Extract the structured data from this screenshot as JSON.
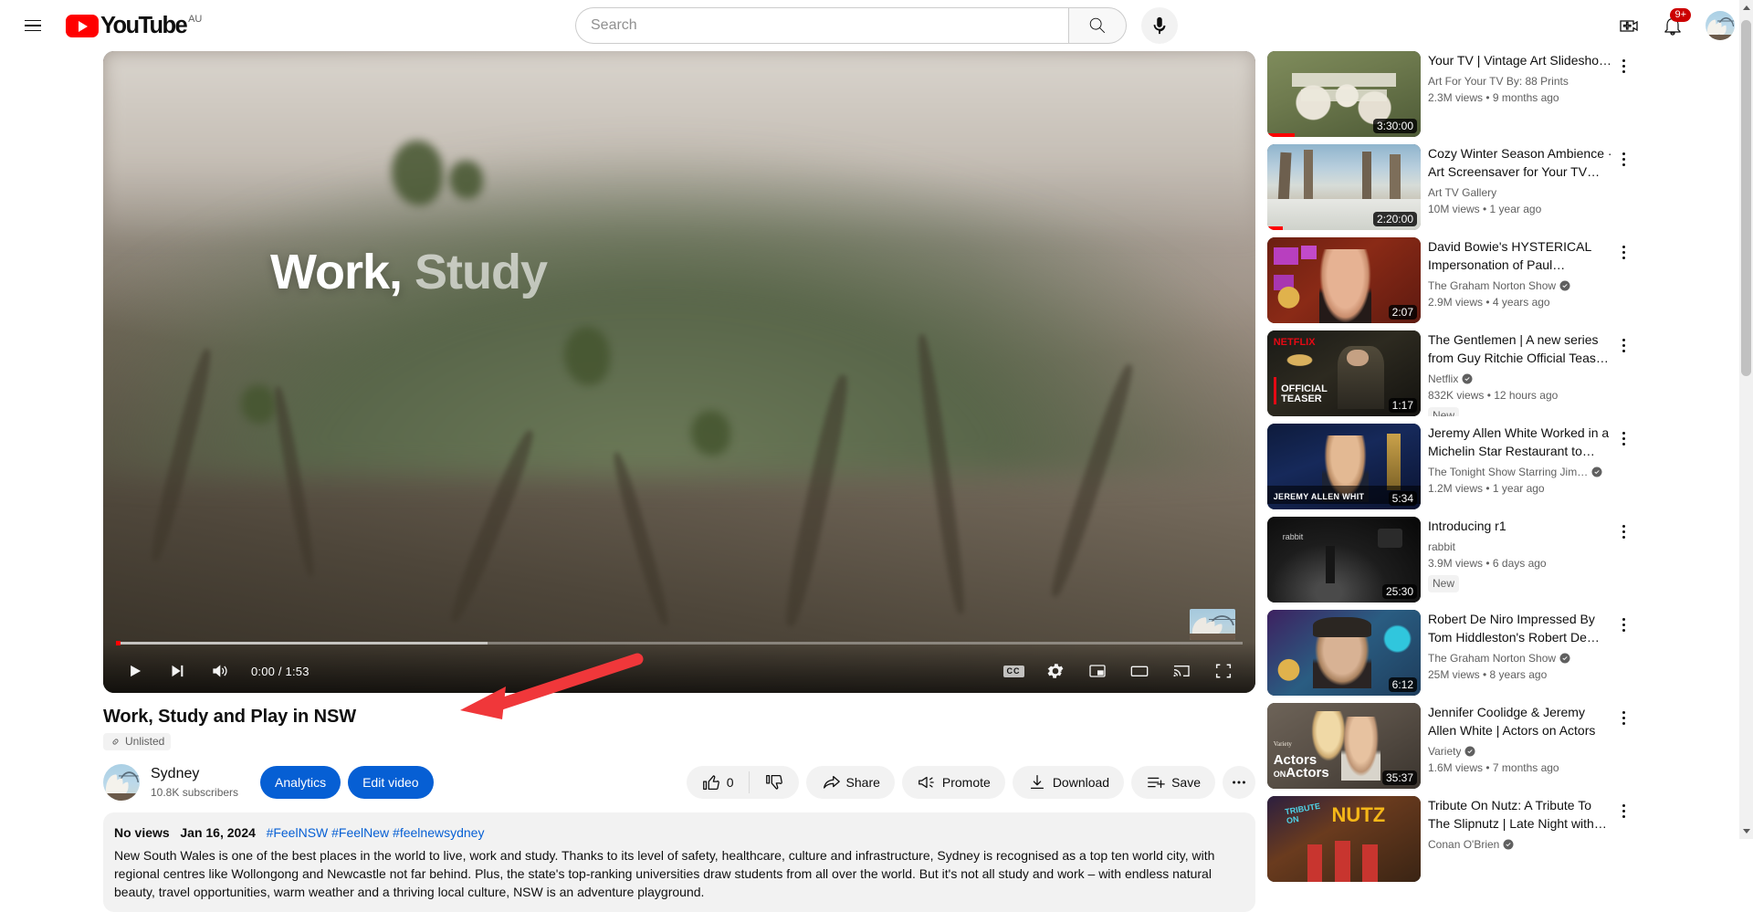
{
  "masthead": {
    "menu_icon": "hamburger-menu-icon",
    "logo_text": "YouTube",
    "country_code": "AU",
    "search": {
      "value": "",
      "placeholder": "Search"
    },
    "search_icon": "search-icon",
    "voice_icon": "microphone-icon",
    "create_icon": "create-video-icon",
    "notifications_icon": "bell-icon",
    "notifications_count": "9+",
    "avatar_icon": "account-avatar"
  },
  "player": {
    "overlay_word_1": "Work,",
    "overlay_word_2": "Study",
    "time_display": "0:00 / 1:53",
    "play_icon": "play-icon",
    "next_icon": "next-video-icon",
    "volume_icon": "volume-icon",
    "captions_label": "CC",
    "settings_icon": "gear-icon",
    "miniplayer_icon": "miniplayer-icon",
    "theater_icon": "theater-mode-icon",
    "cast_icon": "cast-icon",
    "fullscreen_icon": "fullscreen-icon",
    "progress_played_pct": 0.35,
    "progress_loaded_pct": 33
  },
  "video": {
    "title": "Work, Study and Play in NSW",
    "privacy_badge": "Unlisted",
    "privacy_icon": "link-icon",
    "channel_name": "Sydney",
    "channel_subs": "10.8K subscribers",
    "analytics_label": "Analytics",
    "edit_video_label": "Edit video",
    "like_count": "0",
    "like_icon": "thumbs-up-icon",
    "dislike_icon": "thumbs-down-icon",
    "share_label": "Share",
    "share_icon": "share-icon",
    "promote_label": "Promote",
    "promote_icon": "megaphone-icon",
    "download_label": "Download",
    "download_icon": "download-icon",
    "save_label": "Save",
    "save_icon": "save-to-playlist-icon",
    "more_label": "•••"
  },
  "description": {
    "views": "No views",
    "date": "Jan 16, 2024",
    "hashtags": "#FeelNSW #FeelNew #feelnewsydney",
    "body": "New South Wales is one of the best places in the world to live, work and study. Thanks to its level of safety, healthcare, culture and infrastructure, Sydney is recognised as a top ten world city, with regional centres like Wollongong and Newcastle not far behind. Plus, the state's top-ranking universities draw students from all over the world. But it's not all study and work – with endless natural beauty, travel opportunities, warm weather and a thriving local culture, NSW is an adventure playground."
  },
  "related": [
    {
      "title": "Your TV | Vintage Art Slidesho…",
      "channel": "Art For Your TV By: 88 Prints",
      "verified": false,
      "stats": "2.3M views  •  9 months ago",
      "duration": "3:30:00",
      "new": false,
      "watched_pct": 18,
      "thumb": "art-for-your-tv-ducks"
    },
    {
      "title": "Cozy Winter Season Ambience · Art Screensaver for Your TV —…",
      "channel": "Art TV Gallery",
      "verified": false,
      "stats": "10M views  •  1 year ago",
      "duration": "2:20:00",
      "new": false,
      "watched_pct": 10,
      "thumb": "winter-snow-lane"
    },
    {
      "title": "David Bowie's HYSTERICAL Impersonation of Paul…",
      "channel": "The Graham Norton Show",
      "verified": true,
      "stats": "2.9M views  •  4 years ago",
      "duration": "2:07",
      "new": false,
      "watched_pct": 0,
      "thumb": "graham-norton-paul"
    },
    {
      "title": "The Gentlemen | A new series from Guy Ritchie Official Teas…",
      "channel": "Netflix",
      "verified": true,
      "stats": "832K views  •  12 hours ago",
      "duration": "1:17",
      "new": true,
      "watched_pct": 0,
      "thumb": "netflix-gentlemen"
    },
    {
      "title": "Jeremy Allen White Worked in a Michelin Star Restaurant to…",
      "channel": "The Tonight Show Starring Jim…",
      "verified": true,
      "stats": "1.2M views  •  1 year ago",
      "duration": "5:34",
      "new": false,
      "watched_pct": 0,
      "thumb": "tonight-show-jeremy"
    },
    {
      "title": "Introducing r1",
      "channel": "rabbit",
      "verified": false,
      "stats": "3.9M views  •  6 days ago",
      "duration": "25:30",
      "new": true,
      "watched_pct": 0,
      "thumb": "rabbit-r1-stage"
    },
    {
      "title": "Robert De Niro Impressed By Tom Hiddleston's Robert De…",
      "channel": "The Graham Norton Show",
      "verified": true,
      "stats": "25M views  •  8 years ago",
      "duration": "6:12",
      "new": false,
      "watched_pct": 0,
      "thumb": "graham-norton-deniro"
    },
    {
      "title": "Jennifer Coolidge & Jeremy Allen White | Actors on Actors",
      "channel": "Variety",
      "verified": true,
      "stats": "1.6M views  •  7 months ago",
      "duration": "35:37",
      "new": false,
      "watched_pct": 0,
      "thumb": "actors-on-actors"
    },
    {
      "title": "Tribute On Nutz: A Tribute To The Slipnutz | Late Night with…",
      "channel": "Conan O'Brien",
      "verified": true,
      "stats": "",
      "duration": "",
      "new": false,
      "watched_pct": 0,
      "thumb": "tribute-on-nutz"
    }
  ],
  "annotation": {
    "type": "arrow",
    "color": "#f0373a",
    "points_to": "edit-video-button"
  },
  "colors": {
    "brand_red": "#ff0000",
    "accent_blue": "#065fd4",
    "text_primary": "#0f0f0f",
    "text_secondary": "#606060",
    "chip_bg": "#f2f2f2"
  }
}
